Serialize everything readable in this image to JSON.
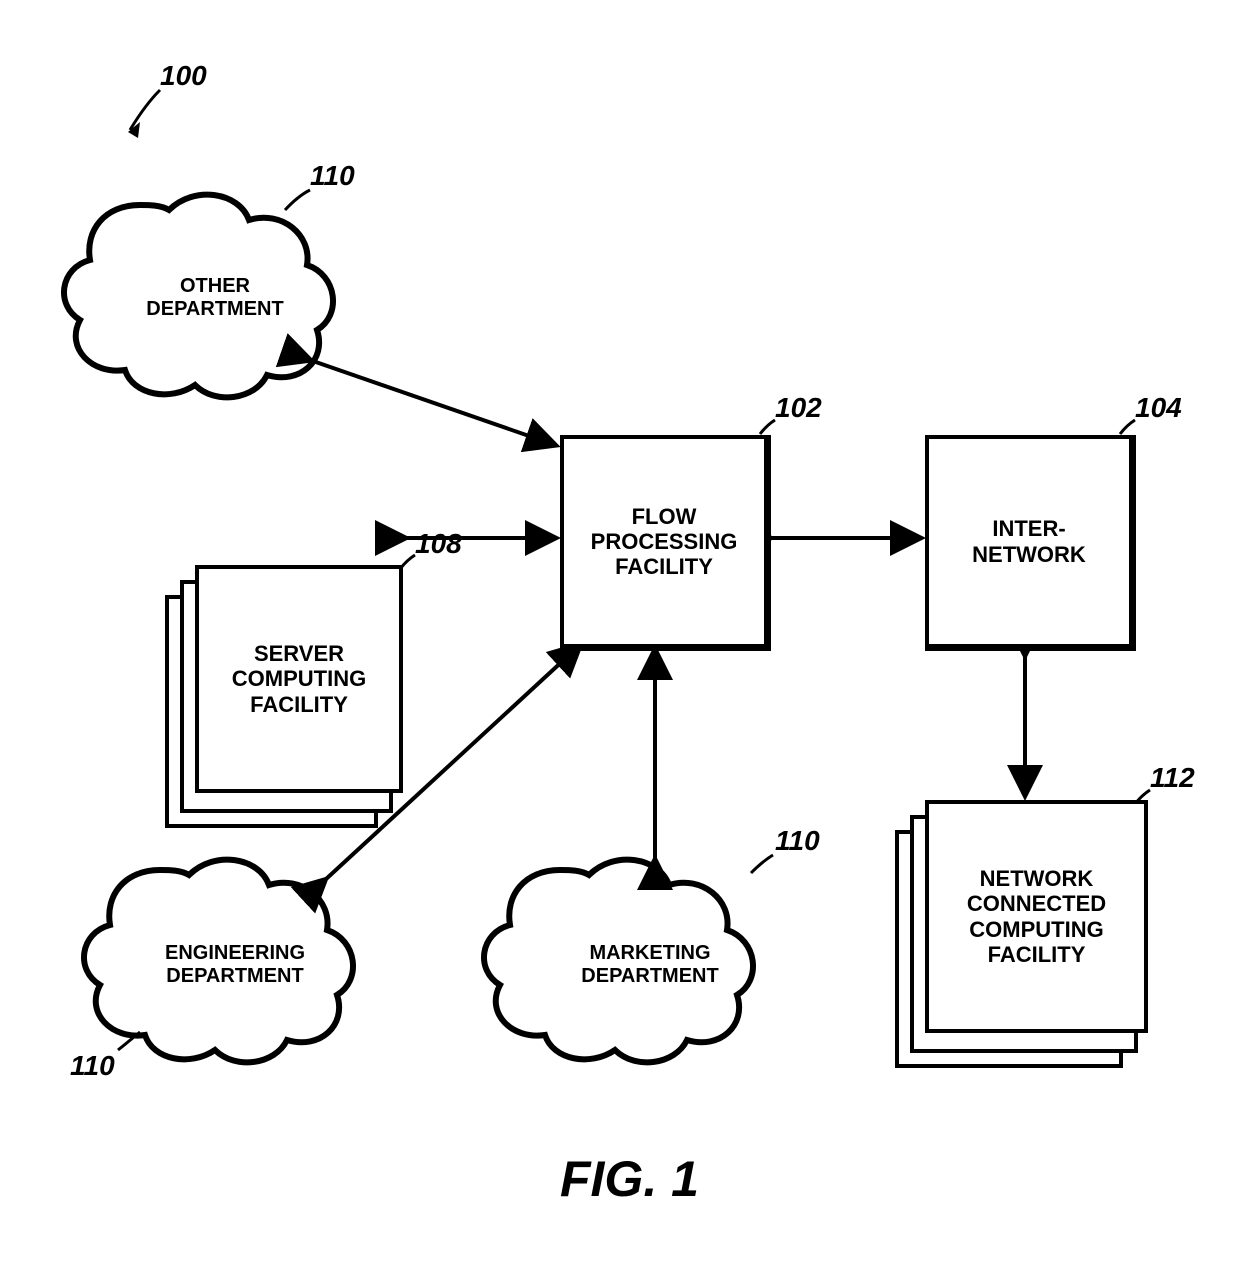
{
  "figure": {
    "caption": "FIG. 1",
    "overall_ref": "100"
  },
  "nodes": {
    "flow": {
      "label": "FLOW\nPROCESSING\nFACILITY",
      "ref": "102"
    },
    "inter": {
      "label": "INTER-\nNETWORK",
      "ref": "104"
    },
    "server": {
      "label": "SERVER\nCOMPUTING\nFACILITY",
      "ref": "108"
    },
    "netconn": {
      "label": "NETWORK\nCONNECTED\nCOMPUTING\nFACILITY",
      "ref": "112"
    },
    "other_dept": {
      "label": "OTHER\nDEPARTMENT",
      "ref": "110"
    },
    "eng_dept": {
      "label": "ENGINEERING\nDEPARTMENT",
      "ref": "110"
    },
    "mkt_dept": {
      "label": "MARKETING\nDEPARTMENT",
      "ref": "110"
    }
  }
}
